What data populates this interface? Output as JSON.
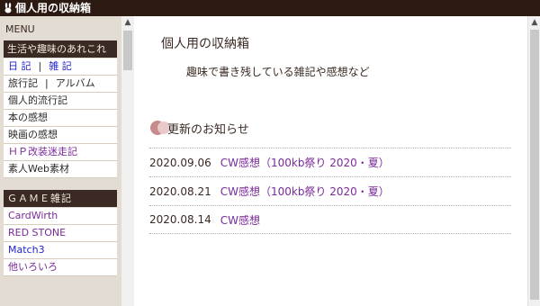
{
  "window": {
    "title": "個人用の収納箱",
    "icon": "rabbit-icon"
  },
  "sidebar": {
    "menu_label": "MENU",
    "section1_title": "生活や趣味のあれこれ",
    "section1_items": [
      {
        "label_a": "日 記",
        "label_b": "雑 記",
        "color": "blue"
      },
      {
        "label_a": "旅行記",
        "label_b": "アルバム",
        "color": "dark"
      },
      {
        "label": "個人的流行記",
        "color": "dark"
      },
      {
        "label": "本の感想",
        "color": "dark"
      },
      {
        "label": "映画の感想",
        "color": "dark"
      },
      {
        "label": "ＨＰ改装迷走記",
        "color": "purple"
      },
      {
        "label": "素人Web素材",
        "color": "dark"
      }
    ],
    "section2_title": "ＧＡＭＥ雑記",
    "section2_items": [
      {
        "label": "CardWirth",
        "color": "purple"
      },
      {
        "label": "RED STONE",
        "color": "purple"
      },
      {
        "label": "Match3",
        "color": "blue"
      },
      {
        "label": "他いろいろ",
        "color": "purple"
      }
    ]
  },
  "main": {
    "title": "個人用の収納箱",
    "subtitle": "趣味で書き残している雑記や感想など",
    "news_heading": "更新のお知らせ",
    "news": [
      {
        "date": "2020.09.06",
        "text": "CW感想（100kb祭り 2020・夏）"
      },
      {
        "date": "2020.08.21",
        "text": "CW感想（100kb祭り 2020・夏）"
      },
      {
        "date": "2020.08.14",
        "text": "CW感想"
      }
    ]
  },
  "colors": {
    "titlebar": "#2b1a12",
    "section_head": "#3b2a24",
    "link_purple": "#7b2a9a",
    "link_blue": "#2222cc",
    "news_dot": "#c98a8c"
  }
}
